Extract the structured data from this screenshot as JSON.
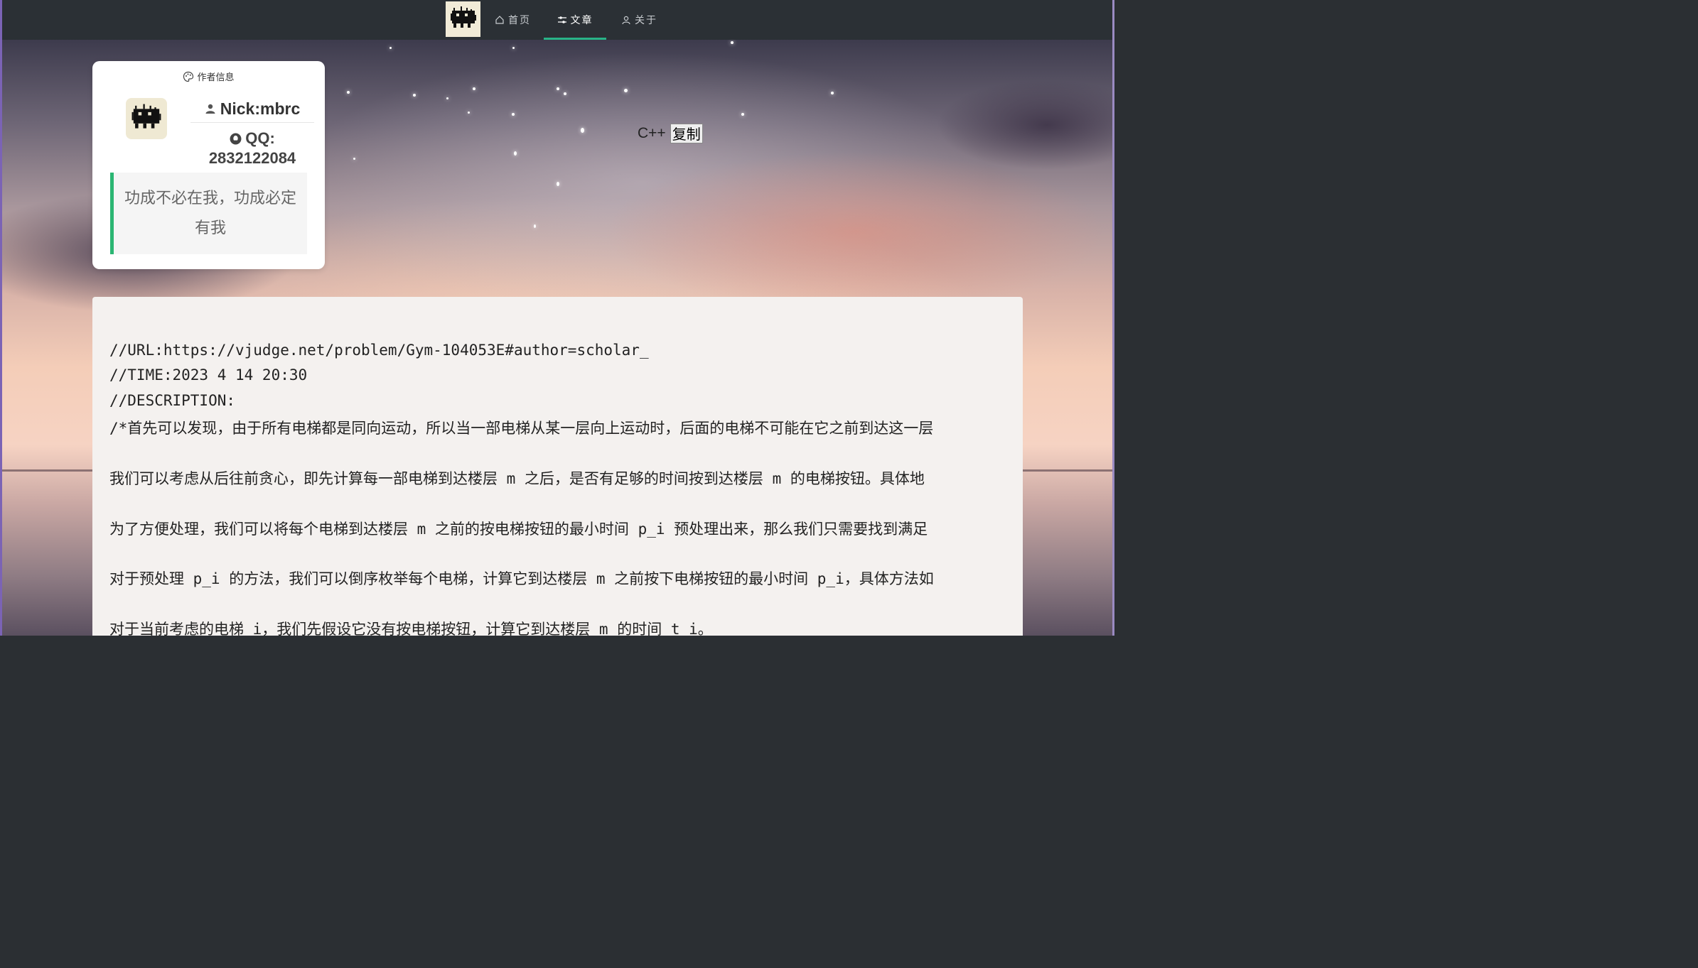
{
  "navbar": {
    "logo_icon": "pixel-monster-logo",
    "items": [
      {
        "label": "首页",
        "icon": "home-icon",
        "active": false
      },
      {
        "label": "文章",
        "icon": "sliders-icon",
        "active": true
      },
      {
        "label": "关于",
        "icon": "user-icon",
        "active": false
      }
    ],
    "active_color": "#28b487"
  },
  "author_card": {
    "title": "作者信息",
    "title_icon": "palette-icon",
    "nick": "Nick:mbrc",
    "nick_icon": "user-icon",
    "qq_label": "QQ:",
    "qq_number": "2832122084",
    "qq_icon": "qq-icon",
    "motto": "功成不必在我，功成必定有我",
    "accent_color": "#2bb673"
  },
  "code_block": {
    "language": "C++",
    "copy_label": "复制",
    "lines": [
      "//URL:https://vjudge.net/problem/Gym-104053E#author=scholar_",
      "//TIME:2023 4 14 20:30",
      "//DESCRIPTION:",
      "/*首先可以发现，由于所有电梯都是同向运动，所以当一部电梯从某一层向上运动时，后面的电梯不可能在它之前到达这一层",
      "",
      "我们可以考虑从后往前贪心，即先计算每一部电梯到达楼层 m 之后，是否有足够的时间按到达楼层 m 的电梯按钮。具体地",
      "",
      "为了方便处理，我们可以将每个电梯到达楼层 m 之前的按电梯按钮的最小时间 p_i 预处理出来，那么我们只需要找到满足",
      "",
      "对于预处理 p_i 的方法，我们可以倒序枚举每个电梯，计算它到达楼层 m 之前按下电梯按钮的最小时间 p_i，具体方法如",
      "",
      "对于当前考虑的电梯 i，我们先假设它没有按电梯按钮，计算它到达楼层 m 的时间 t_i。"
    ]
  }
}
